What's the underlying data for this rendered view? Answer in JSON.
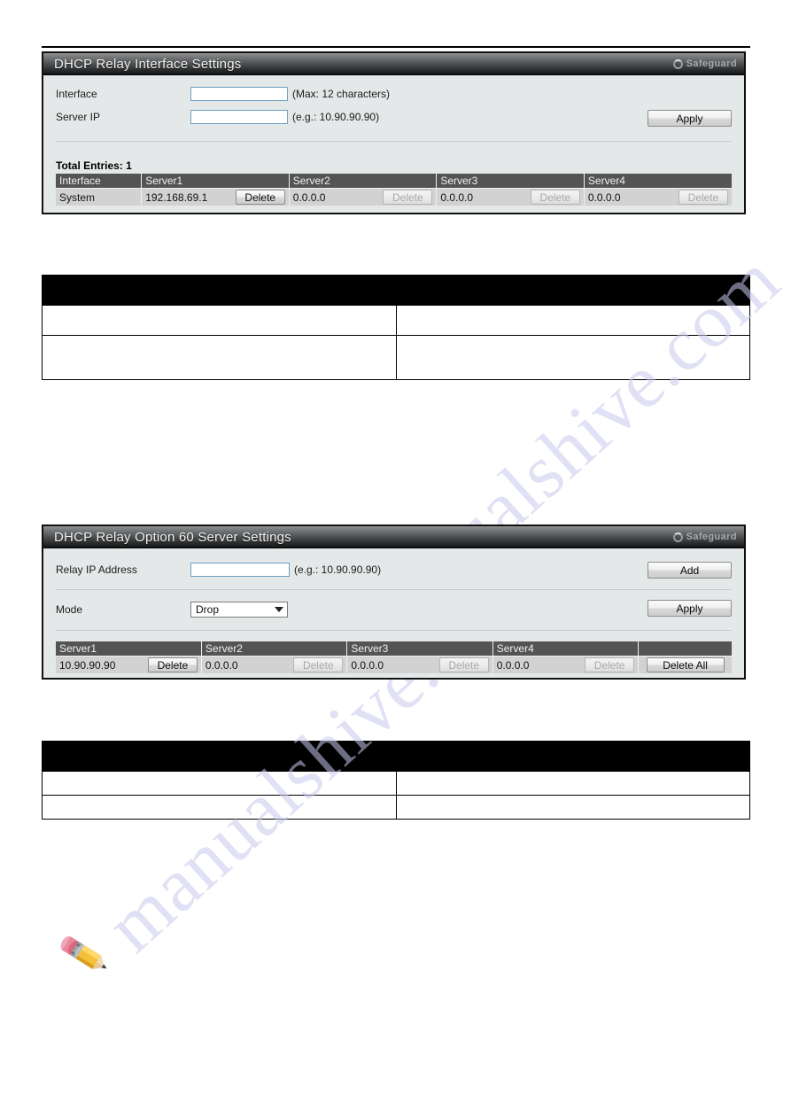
{
  "watermark": {
    "text": "manualshive.com"
  },
  "panels": [
    {
      "id": "interface",
      "title": "DHCP Relay Interface Settings",
      "safeguard_label": "Safeguard",
      "fields": [
        {
          "label": "Interface",
          "value": "",
          "hint": "(Max: 12 characters)"
        },
        {
          "label": "Server IP",
          "value": "",
          "hint": "(e.g.: 10.90.90.90)"
        }
      ],
      "apply_label": "Apply",
      "total_entries_label": "Total Entries: 1",
      "table": {
        "headers": [
          "Interface",
          "Server1",
          "Server2",
          "Server3",
          "Server4"
        ],
        "rows": [
          {
            "interface": "System",
            "server1": "192.168.69.1",
            "server1_btn": "Delete",
            "server1_btn_enabled": true,
            "server2": "0.0.0.0",
            "server2_btn": "Delete",
            "server2_btn_enabled": false,
            "server3": "0.0.0.0",
            "server3_btn": "Delete",
            "server3_btn_enabled": false,
            "server4": "0.0.0.0",
            "server4_btn": "Delete",
            "server4_btn_enabled": false
          }
        ]
      }
    },
    {
      "id": "option60",
      "title": "DHCP Relay Option 60 Server Settings",
      "safeguard_label": "Safeguard",
      "relay_ip_label": "Relay IP Address",
      "relay_ip_value": "",
      "relay_ip_hint": "(e.g.: 10.90.90.90)",
      "add_label": "Add",
      "mode_label": "Mode",
      "mode_value": "Drop",
      "mode_options": [
        "Drop"
      ],
      "apply_label": "Apply",
      "table": {
        "headers": [
          "Server1",
          "Server2",
          "Server3",
          "Server4",
          ""
        ],
        "rows": [
          {
            "server1": "10.90.90.90",
            "server1_btn": "Delete",
            "server1_btn_enabled": true,
            "server2": "0.0.0.0",
            "server2_btn": "Delete",
            "server2_btn_enabled": false,
            "server3": "0.0.0.0",
            "server3_btn": "Delete",
            "server3_btn_enabled": false,
            "server4": "0.0.0.0",
            "server4_btn": "Delete",
            "server4_btn_enabled": false,
            "delete_all_btn": "Delete All"
          }
        ]
      }
    }
  ],
  "desc_tables": [
    {
      "id": "desc-1",
      "header": "",
      "rows": [
        {
          "name": "",
          "description": ""
        },
        {
          "name": "",
          "description": ""
        }
      ]
    },
    {
      "id": "desc-2",
      "header": "",
      "rows": [
        {
          "name": "",
          "description": ""
        },
        {
          "name": "",
          "description": ""
        }
      ]
    }
  ],
  "note": {
    "icon": "pencil-icon"
  },
  "colors": {
    "panel_bg": "#e4e8e8",
    "title_bar_dark": "#141516",
    "table_header": "#545454",
    "table_row": "#d2d2d2",
    "input_border": "#6f9fc4",
    "watermark": "#c9c9ee",
    "pencil_body": "#f5c13b",
    "pencil_eraser": "#e8879c"
  }
}
